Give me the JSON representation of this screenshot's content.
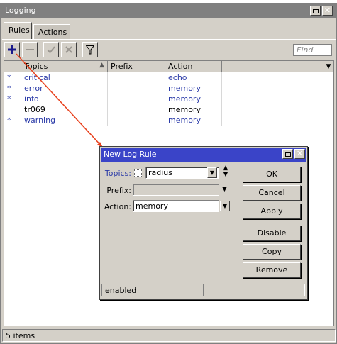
{
  "window": {
    "title": "Logging"
  },
  "tabs": [
    {
      "label": "Rules"
    },
    {
      "label": "Actions"
    }
  ],
  "toolbar": {
    "find_placeholder": "Find"
  },
  "table": {
    "columns": [
      "Topics",
      "Prefix",
      "Action"
    ],
    "rows": [
      {
        "flag": "*",
        "topics": "critical",
        "prefix": "",
        "action": "echo"
      },
      {
        "flag": "*",
        "topics": "error",
        "prefix": "",
        "action": "memory"
      },
      {
        "flag": "*",
        "topics": "info",
        "prefix": "",
        "action": "memory"
      },
      {
        "flag": "",
        "topics": "tr069",
        "prefix": "",
        "action": "memory"
      },
      {
        "flag": "*",
        "topics": "warning",
        "prefix": "",
        "action": "memory"
      }
    ]
  },
  "status": {
    "items_count": "5 items"
  },
  "dialog": {
    "title": "New Log Rule",
    "fields": {
      "topics_label": "Topics:",
      "topics_value": "radius",
      "prefix_label": "Prefix:",
      "prefix_value": "",
      "action_label": "Action:",
      "action_value": "memory"
    },
    "buttons": [
      "OK",
      "Cancel",
      "Apply",
      "Disable",
      "Copy",
      "Remove"
    ],
    "status": "enabled"
  },
  "colors": {
    "window_bg": "#d4d0c8",
    "title_inactive": "#808080",
    "title_active": "#3a44c8",
    "link_blue": "#2a3aa8",
    "callout_arrow": "#e8401c"
  }
}
